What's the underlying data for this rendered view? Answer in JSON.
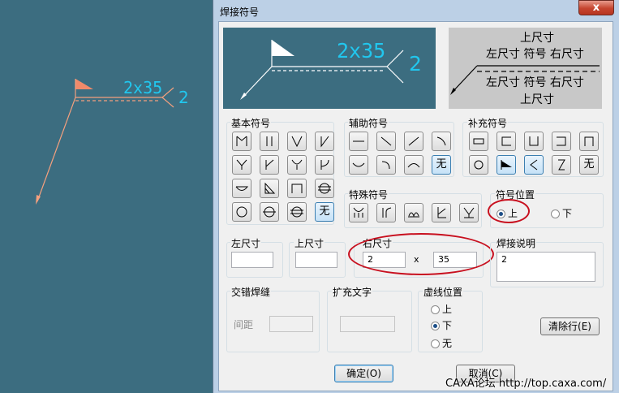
{
  "canvas": {
    "weld_dimension_text": "2x35",
    "weld_side_text": "2"
  },
  "dialog": {
    "title": "焊接符号",
    "close_label": "x",
    "preview": {
      "dimension_text": "2x35",
      "side_text": "2"
    },
    "legend": {
      "upper_dim": "上尺寸",
      "row_top": "左尺寸 符号 右尺寸",
      "row_bottom": "左尺寸 符号 右尺寸",
      "lower_dim": "上尺寸"
    },
    "groups": {
      "basic": "基本符号",
      "auxiliary": "辅助符号",
      "supplementary": "补充符号",
      "special": "特殊符号",
      "symbol_position": "符号位置",
      "left_dim": "左尺寸",
      "upper_dim": "上尺寸",
      "right_dim": "右尺寸",
      "weld_note": "焊接说明",
      "staggered": "交错焊缝",
      "ext_text": "扩充文字",
      "dash_position": "虚线位置"
    },
    "none_label": "无",
    "symbol_position_options": {
      "up": "上",
      "down": "下",
      "selected": "上"
    },
    "dash_position_options": {
      "up": "上",
      "down": "下",
      "none": "无",
      "selected": "下"
    },
    "fields": {
      "left_dim": "",
      "upper_dim": "",
      "right_dim_a": "2",
      "right_dim_x": "x",
      "right_dim_b": "35",
      "weld_note": "2",
      "spacing_label": "间距",
      "spacing": "",
      "ext_text": ""
    },
    "buttons": {
      "clear_line": "清除行(E)",
      "ok": "确定(O)",
      "cancel": "取消(C)"
    }
  },
  "watermark": "CAXA论坛 http://top.caxa.com/",
  "colors": {
    "canvas_bg": "#3c6d80",
    "canvas_line": "#f4a07e",
    "canvas_text": "#21c7ee",
    "preview_bg": "#3c6d80",
    "annotation_red": "#c8101f"
  }
}
